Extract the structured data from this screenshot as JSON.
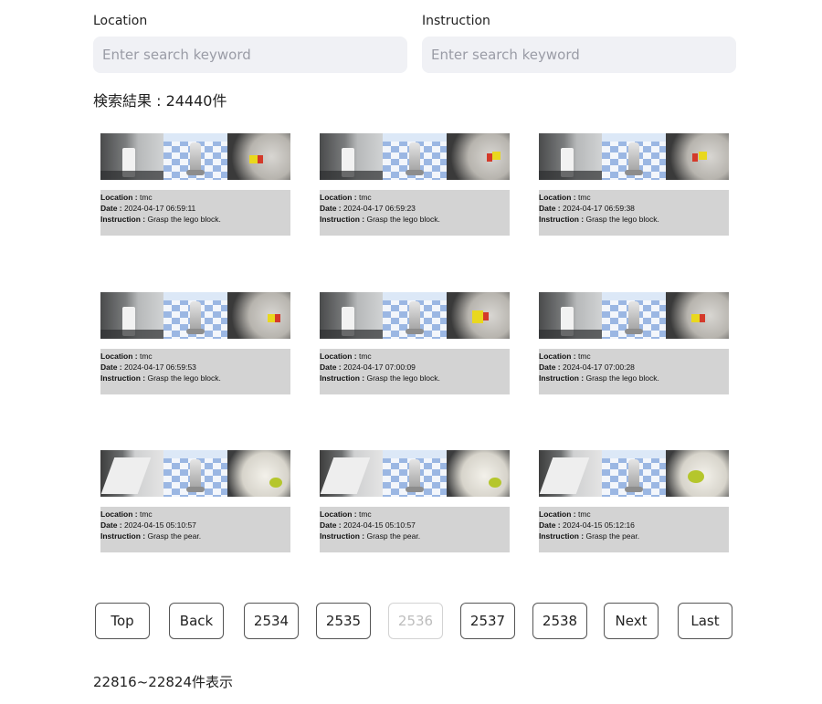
{
  "search": {
    "location_label": "Location",
    "location_placeholder": "Enter search keyword",
    "instruction_label": "Instruction",
    "instruction_placeholder": "Enter search keyword"
  },
  "result_count": "検索結果 : 24440件",
  "field_labels": {
    "location": "Location : ",
    "date": "Date : ",
    "instruction": "Instruction : "
  },
  "results": [
    {
      "location": "tmc",
      "date": "2024-04-17 06:59:11",
      "instruction": "Grasp the lego block."
    },
    {
      "location": "tmc",
      "date": "2024-04-17 06:59:23",
      "instruction": "Grasp the lego block."
    },
    {
      "location": "tmc",
      "date": "2024-04-17 06:59:38",
      "instruction": "Grasp the lego block."
    },
    {
      "location": "tmc",
      "date": "2024-04-17 06:59:53",
      "instruction": "Grasp the lego block."
    },
    {
      "location": "tmc",
      "date": "2024-04-17 07:00:09",
      "instruction": "Grasp the lego block."
    },
    {
      "location": "tmc",
      "date": "2024-04-17 07:00:28",
      "instruction": "Grasp the lego block."
    },
    {
      "location": "tmc",
      "date": "2024-04-15 05:10:57",
      "instruction": "Grasp the pear."
    },
    {
      "location": "tmc",
      "date": "2024-04-15 05:10:57",
      "instruction": "Grasp the pear."
    },
    {
      "location": "tmc",
      "date": "2024-04-15 05:12:16",
      "instruction": "Grasp the pear."
    }
  ],
  "pagination": {
    "top": "Top",
    "back": "Back",
    "pages": [
      "2534",
      "2535",
      "2536",
      "2537",
      "2538"
    ],
    "current_page": "2536",
    "next": "Next",
    "last": "Last"
  },
  "range_text": "22816~22824件表示"
}
